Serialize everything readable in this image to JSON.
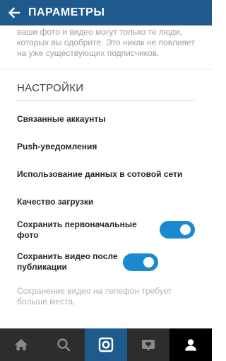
{
  "header": {
    "title": "ПАРАМЕТРЫ",
    "back_icon": "arrow-left-icon",
    "background": "#1e5a8c"
  },
  "intro": {
    "text": "ваши фото и видео могут только те люди, которых вы одобрите. Это никак не повлияет на уже существующих подписчиков."
  },
  "settings": {
    "section_title": "НАСТРОЙКИ",
    "items": [
      {
        "label": "Связанные аккаунты"
      },
      {
        "label": "Push-уведомления"
      },
      {
        "label": "Использование данных в сотовой сети"
      },
      {
        "label": "Качество загрузки"
      }
    ],
    "toggles": [
      {
        "label": "Сохранить первоначальные фото",
        "on": true
      },
      {
        "label": "Сохранить видео после публикации",
        "on": true
      }
    ],
    "note": "Сохранение видео на телефон требует больше места.",
    "accent": "#1b89d0"
  },
  "tabbar": {
    "tabs": [
      {
        "icon": "home-icon",
        "active": false
      },
      {
        "icon": "search-icon",
        "active": false
      },
      {
        "icon": "camera-icon",
        "active": true
      },
      {
        "icon": "activity-heart-icon",
        "active": false
      },
      {
        "icon": "profile-icon",
        "active": false
      }
    ]
  }
}
